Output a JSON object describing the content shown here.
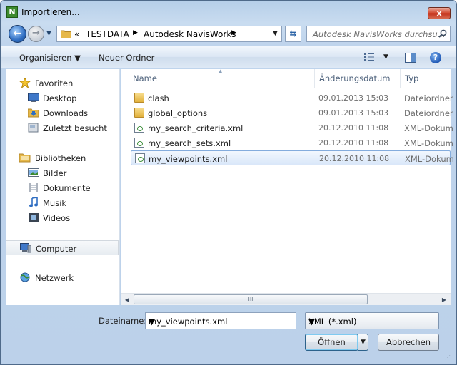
{
  "window": {
    "title": "Importieren...",
    "close_label": "x",
    "app_icon_letter": "N"
  },
  "address_bar": {
    "overflow_label": "«",
    "crumbs": [
      "TESTDATA",
      "Autodesk NavisWorks"
    ],
    "search_placeholder": "Autodesk NavisWorks durchsu..."
  },
  "command_bar": {
    "organize_label": "Organisieren",
    "new_folder_label": "Neuer Ordner"
  },
  "navigation": {
    "groups": [
      {
        "label": "Favoriten",
        "icon": "star-icon"
      },
      {
        "label": "Desktop",
        "icon": "desktop-icon"
      },
      {
        "label": "Downloads",
        "icon": "downloads-icon"
      },
      {
        "label": "Zuletzt besucht",
        "icon": "recent-places-icon"
      },
      {
        "label": "Bibliotheken",
        "icon": "libraries-icon"
      },
      {
        "label": "Bilder",
        "icon": "pictures-icon"
      },
      {
        "label": "Dokumente",
        "icon": "documents-icon"
      },
      {
        "label": "Musik",
        "icon": "music-icon"
      },
      {
        "label": "Videos",
        "icon": "videos-icon"
      },
      {
        "label": "Computer",
        "icon": "computer-icon"
      },
      {
        "label": "Netzwerk",
        "icon": "network-icon"
      }
    ]
  },
  "file_list": {
    "columns": {
      "name": "Name",
      "date": "Änderungsdatum",
      "type": "Typ"
    },
    "rows": [
      {
        "name": "clash",
        "date": "09.01.2013 15:03",
        "type": "Dateiordner",
        "icon": "folder-icon"
      },
      {
        "name": "global_options",
        "date": "09.01.2013 15:03",
        "type": "Dateiordner",
        "icon": "folder-icon"
      },
      {
        "name": "my_search_criteria.xml",
        "date": "20.12.2010 11:08",
        "type": "XML-Dokum",
        "icon": "xml-file-icon"
      },
      {
        "name": "my_search_sets.xml",
        "date": "20.12.2010 11:08",
        "type": "XML-Dokum",
        "icon": "xml-file-icon"
      },
      {
        "name": "my_viewpoints.xml",
        "date": "20.12.2010 11:08",
        "type": "XML-Dokum",
        "icon": "xml-file-icon"
      }
    ],
    "scroll_thumb_grip": "III"
  },
  "footer": {
    "filename_label": "Dateiname:",
    "filename_value": "my_viewpoints.xml",
    "filetype_value": "XML (*.xml)",
    "open_label": "Öffnen",
    "cancel_label": "Abbrechen"
  },
  "colors": {
    "frame": "#bcd1ea",
    "selection_border": "#84acdd",
    "selection_fill": "#d9e7f9"
  }
}
